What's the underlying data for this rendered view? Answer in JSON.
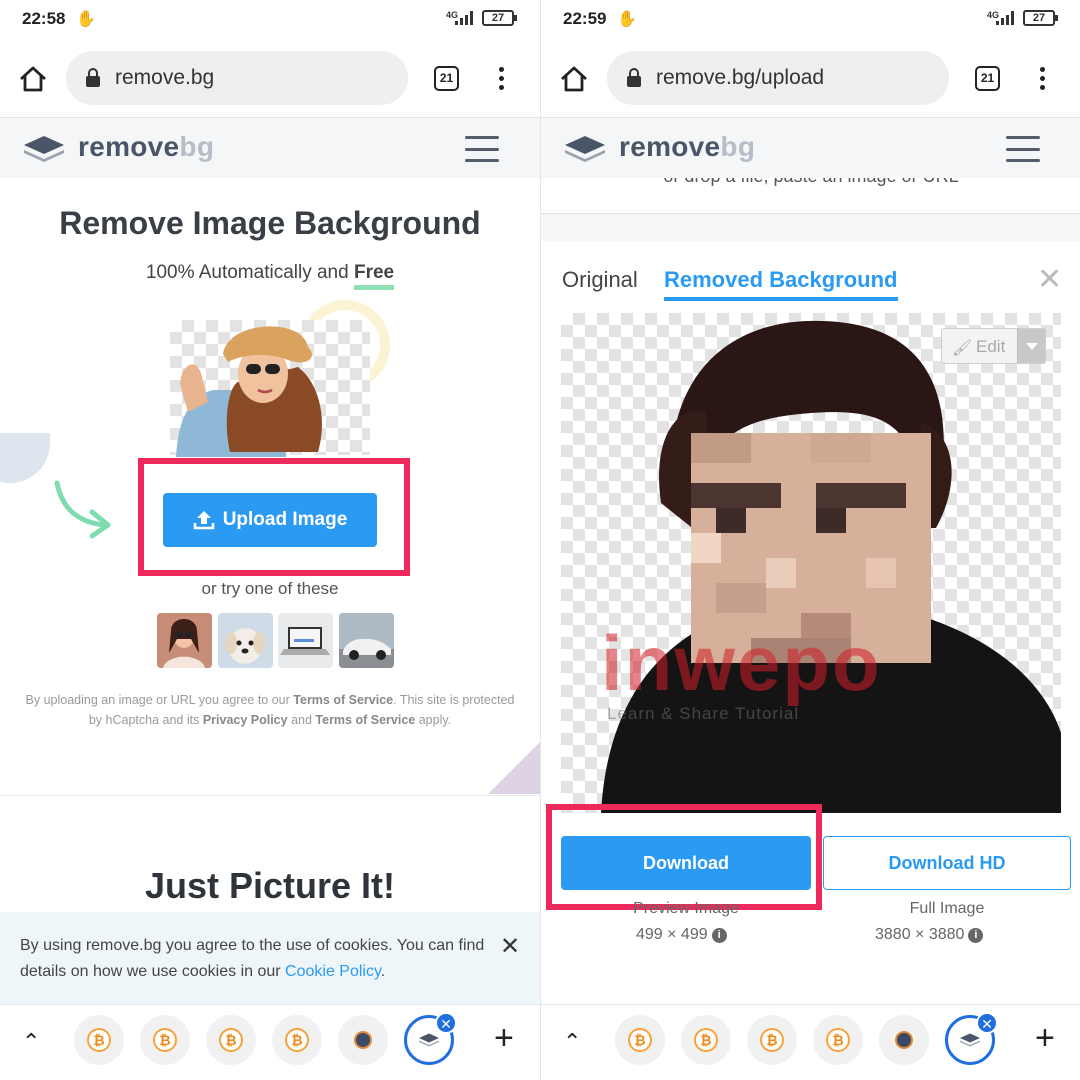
{
  "left": {
    "status": {
      "time": "22:58",
      "network": "4G",
      "battery": "27"
    },
    "browser": {
      "url": "remove.bg",
      "tab_count": "21"
    },
    "site": {
      "brand_main": "remove",
      "brand_suffix": "bg"
    },
    "hero": {
      "title": "Remove Image Background",
      "subtitle_prefix": "100% Automatically and ",
      "subtitle_emphasis": "Free"
    },
    "upload_button": "Upload Image",
    "try_text": "or try one of these",
    "terms": {
      "p1": "By uploading an image or URL you agree to our ",
      "tos": "Terms of Service",
      "p2": ". This site is protected by hCaptcha and its ",
      "privacy": "Privacy Policy",
      "p3": " and ",
      "tos2": "Terms of Service",
      "p4": " apply."
    },
    "section_title": "Just Picture It!",
    "cookie": {
      "text": "By using remove.bg you agree to the use of cookies. You can find details on how we use cookies in our ",
      "link": "Cookie Policy",
      "end": "."
    },
    "close_symbol": "✕"
  },
  "right": {
    "status": {
      "time": "22:59",
      "network": "4G",
      "battery": "27"
    },
    "browser": {
      "url": "remove.bg/upload",
      "tab_count": "21"
    },
    "site": {
      "brand_main": "remove",
      "brand_suffix": "bg"
    },
    "ghost_text": "or drop a file, paste an image or URL",
    "tabs": {
      "original": "Original",
      "removed": "Removed Background"
    },
    "edit_label": "Edit",
    "download": "Download",
    "download_hd": "Download HD",
    "preview_label": "Preview Image",
    "preview_dim": "499 × 499",
    "full_label": "Full Image",
    "full_dim": "3880 × 3880",
    "watermark": "inwepo",
    "watermark_sub": "Learn & Share Tutorial"
  },
  "bottom_tabs": {
    "btc_symbol": "₿",
    "plus": "+",
    "chevron": "⌃",
    "close_badge": "✕"
  },
  "colors": {
    "accent": "#2b9af3",
    "highlight": "#ee2a5d",
    "free_underline": "#8fe0b5"
  }
}
